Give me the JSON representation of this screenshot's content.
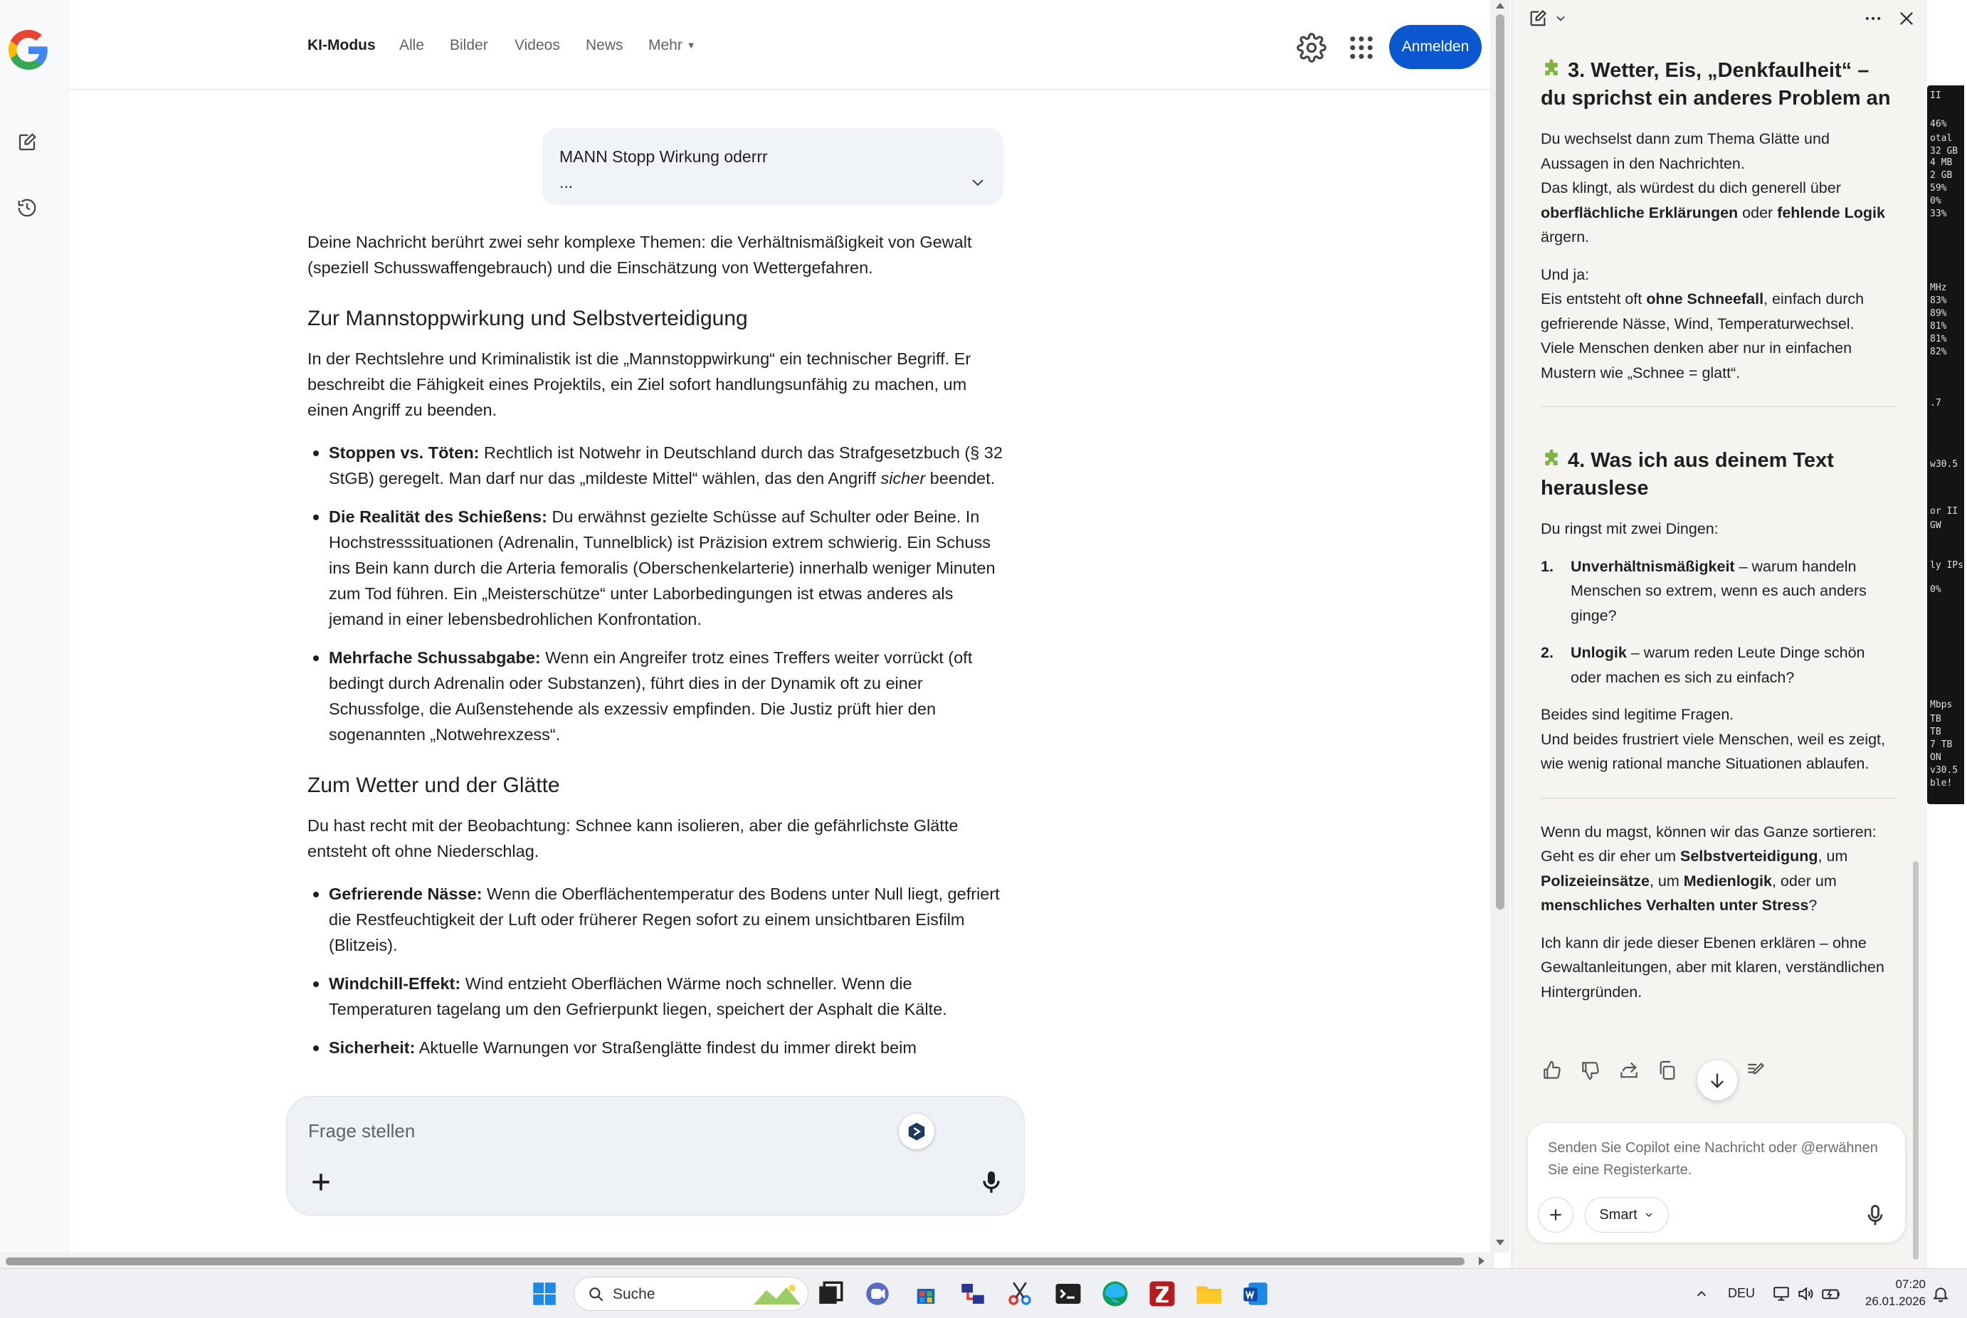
{
  "nav": {
    "tabs": [
      "KI-Modus",
      "Alle",
      "Bilder",
      "Videos",
      "News",
      "Mehr"
    ],
    "signin_label": "Anmelden"
  },
  "query": {
    "line1": "MANN Stopp Wirkung oderrr",
    "line2": "..."
  },
  "answer": {
    "intro": "Deine Nachricht berührt zwei sehr komplexe Themen: die Verhältnismäßigkeit von Gewalt (speziell Schusswaffengebrauch) und die Einschätzung von Wettergefahren.",
    "section1_title": "Zur Mannstoppwirkung und Selbstverteidigung",
    "section1_text": "In der Rechtslehre und Kriminalistik ist die „Mannstoppwirkung“ ein technischer Begriff. Er beschreibt die Fähigkeit eines Projektils, ein Ziel sofort handlungsunfähig zu machen, um einen Angriff zu beenden.",
    "s1_b1_title": "Stoppen vs. Töten:",
    "s1_b1_text": " Rechtlich ist Notwehr in Deutschland durch das Strafgesetzbuch (§ 32 StGB) geregelt. Man darf nur das „mildeste Mittel“ wählen, das den Angriff ",
    "s1_b1_em": "sicher",
    "s1_b1_end": " beendet.",
    "s1_b2_title": "Die Realität des Schießens:",
    "s1_b2_text": " Du erwähnst gezielte Schüsse auf Schulter oder Beine. In Hochstresssituationen (Adrenalin, Tunnelblick) ist Präzision extrem schwierig. Ein Schuss ins Bein kann durch die Arteria femoralis (Oberschenkelarterie) innerhalb weniger Minuten zum Tod führen. Ein „Meisterschütze“ unter Laborbedingungen ist etwas anderes als jemand in einer lebensbedrohlichen Konfrontation.",
    "s1_b3_title": "Mehrfache Schussabgabe:",
    "s1_b3_text": " Wenn ein Angreifer trotz eines Treffers weiter vorrückt (oft bedingt durch Adrenalin oder Substanzen), führt dies in der Dynamik oft zu einer Schussfolge, die Außenstehende als exzessiv empfinden. Die Justiz prüft hier den sogenannten „Notwehrexzess“.",
    "section2_title": "Zum Wetter und der Glätte",
    "section2_text": "Du hast recht mit der Beobachtung: Schnee kann isolieren, aber die gefährlichste Glätte entsteht oft ohne Niederschlag.",
    "s2_b1_title": "Gefrierende Nässe:",
    "s2_b1_text": " Wenn die Oberflächentemperatur des Bodens unter Null liegt, gefriert die Restfeuchtigkeit der Luft oder früherer Regen sofort zu einem unsichtbaren Eisfilm (Blitzeis).",
    "s2_b2_title": "Windchill-Effekt:",
    "s2_b2_text": " Wind entzieht Oberflächen Wärme noch schneller. Wenn die Temperaturen tagelang um den Gefrierpunkt liegen, speichert der Asphalt die Kälte.",
    "s2_b3_title": "Sicherheit:",
    "s2_b3_text": " Aktuelle Warnungen vor Straßenglätte findest du immer direkt beim"
  },
  "ask": {
    "placeholder": "Frage stellen"
  },
  "copilot": {
    "h3": "3. Wetter, Eis, „Denkfaulheit“ – du sprichst ein anderes Problem an",
    "p3a_1": "Du wechselst dann zum Thema Glätte und Aussagen in den Nachrichten.",
    "p3a_2": "Das klingt, als würdest du dich generell über ",
    "p3a_b1": "oberflächliche Erklärungen",
    "p3a_3": " oder ",
    "p3a_b2": "fehlende Logik",
    "p3a_4": " ärgern.",
    "p3b_1": "Und ja:",
    "p3b_2": "Eis entsteht oft ",
    "p3b_b": "ohne Schneefall",
    "p3b_3": ", einfach durch gefrierende Nässe, Wind, Temperaturwechsel.",
    "p3b_4": "Viele Menschen denken aber nur in einfachen Mustern wie „Schnee = glatt“.",
    "h4": "4. Was ich aus deinem Text herauslese",
    "p4_intro": "Du ringst mit zwei Dingen:",
    "li1_num": "1.",
    "li1_b": "Unverhältnismäßigkeit",
    "li1_text": " – warum handeln Menschen so extrem, wenn es auch anders ginge?",
    "li2_num": "2.",
    "li2_b": "Unlogik",
    "li2_text": " – warum reden Leute Dinge schön oder machen es sich zu einfach?",
    "p4b_1": "Beides sind legitime Fragen.",
    "p4b_2": "Und beides frustriert viele Menschen, weil es zeigt, wie wenig rational manche Situationen ablaufen.",
    "p5_1": "Wenn du magst, können wir das Ganze sortieren: Geht es dir eher um ",
    "p5_b1": "Selbstverteidigung",
    "p5_2": ", um ",
    "p5_b2": "Polizeieinsätze",
    "p5_3": ", um ",
    "p5_b3": "Medienlogik",
    "p5_4": ", oder um ",
    "p5_b4": "menschliches Verhalten unter Stress",
    "p5_5": "?",
    "p6": "Ich kann dir jede dieser Ebenen erklären – ohne Gewaltanleitungen, aber mit klaren, verständlichen Hintergründen.",
    "composer_placeholder": "Senden Sie Copilot eine Nachricht oder @erwähnen Sie eine Registerkarte.",
    "smart_label": "Smart"
  },
  "widget": {
    "lines": [
      "II",
      "46%",
      "otal",
      "32 GB",
      "4 MB",
      "2 GB",
      "59%",
      "0%",
      "33%",
      "MHz",
      "83%",
      "89%",
      "81%",
      "81%",
      "82%",
      ".7",
      "w30.5",
      "or II",
      "GW",
      "ly IPs",
      "0%",
      "Mbps",
      "TB",
      "TB",
      "7 TB",
      "ON",
      "v30.5",
      "ble!"
    ]
  },
  "taskbar": {
    "search_label": "Suche",
    "language": "DEU",
    "time": "07:20",
    "date": "26.01.2026"
  },
  "colors": {
    "google_blue": "#0b57d0",
    "copilot_bg": "#f6f4f1",
    "puzzle_green": "#7cb342"
  }
}
